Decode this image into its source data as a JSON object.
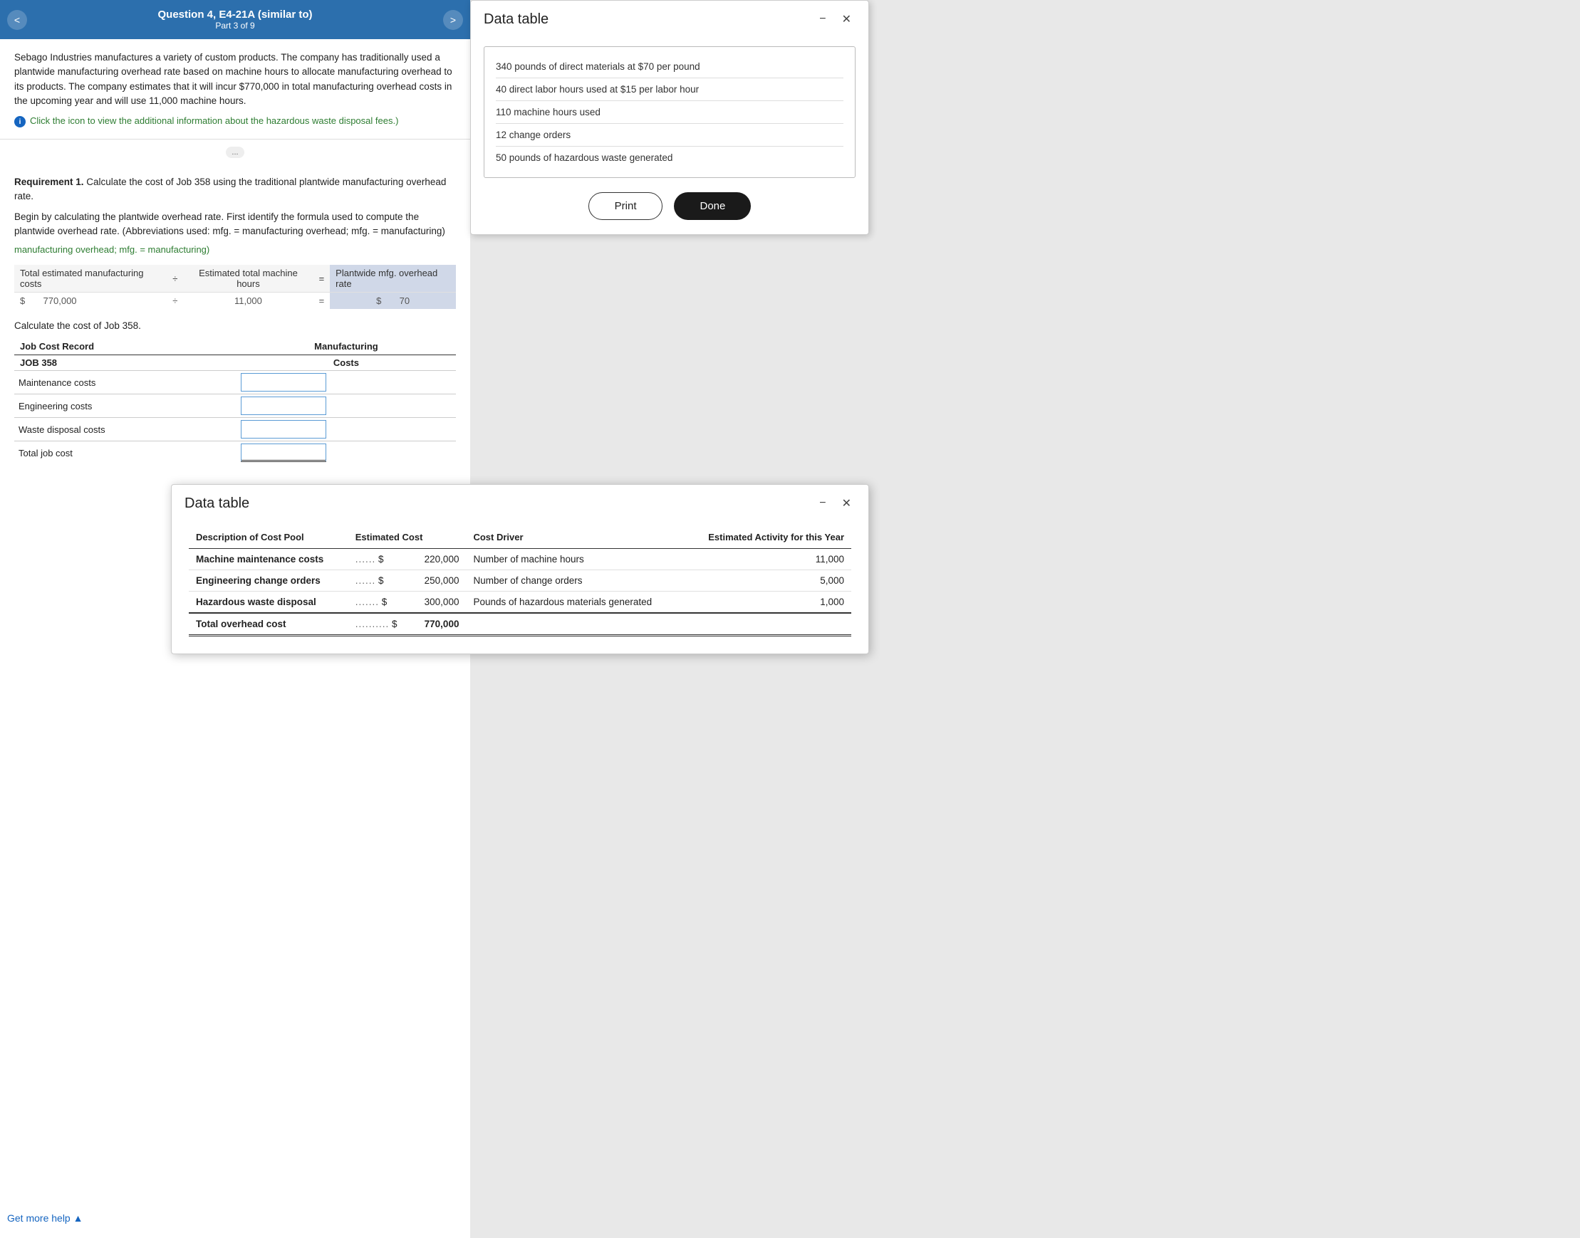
{
  "header": {
    "title": "Question 4, E4-21A (similar to)",
    "subtitle": "Part 3 of 9",
    "prev_label": "<",
    "next_label": ">"
  },
  "problem": {
    "text": "Sebago Industries manufactures a variety of custom products. The company has traditionally used a plantwide manufacturing overhead rate based on machine hours to allocate manufacturing overhead to its products. The company estimates that it will incur $770,000 in total manufacturing overhead costs in the upcoming year and will use 11,000 machine hours.",
    "info_link": "Click the icon to view the additional information about the hazardous waste disposal fees.)"
  },
  "scroll_indicator": "...",
  "requirement": {
    "text_bold": "Requirement 1.",
    "text_rest": " Calculate the cost of Job 358 using the traditional plantwide manufacturing overhead rate.",
    "begin_text": "Begin by calculating the plantwide overhead rate. First identify the formula used to compute the plantwide overhead rate. (Abbreviations used: mfg. = manufacturing overhead; mfg. = manufacturing)",
    "formula_note": "manufacturing overhead; mfg. = manufacturing)"
  },
  "formula_table": {
    "col1_header": "Total estimated manufacturing costs",
    "col2_header": "÷",
    "col3_header": "Estimated total machine hours",
    "col4_header": "=",
    "col5_header": "Plantwide mfg. overhead rate",
    "row_dollar": "$",
    "row_val1": "770,000",
    "row_div": "÷",
    "row_val2": "11,000",
    "row_eq": "=",
    "row_dollar2": "$",
    "row_result": "70"
  },
  "calc_label": "Calculate the cost of Job 358.",
  "job_table": {
    "col1_header": "Job Cost Record",
    "col2_header": "Manufacturing",
    "sub1": "JOB 358",
    "sub2": "Costs",
    "rows": [
      {
        "label": "Maintenance costs",
        "value": ""
      },
      {
        "label": "Engineering costs",
        "value": ""
      },
      {
        "label": "Waste disposal costs",
        "value": ""
      }
    ],
    "total_label": "Total job cost"
  },
  "modal1": {
    "title": "Data table",
    "items": [
      "340 pounds of direct materials at $70 per pound",
      "40 direct labor hours used at $15 per labor hour",
      "110 machine hours used",
      "12 change orders",
      "50 pounds of hazardous waste generated"
    ],
    "print_label": "Print",
    "done_label": "Done"
  },
  "modal2": {
    "title": "Data table",
    "table": {
      "col_headers": [
        "Description of Cost Pool",
        "Estimated Cost",
        "Cost Driver",
        "Estimated Activity for this Year"
      ],
      "rows": [
        {
          "description": "Machine maintenance costs",
          "dots": "......",
          "dollar": "$",
          "cost": "220,000",
          "driver": "Number of machine hours",
          "activity": "11,000"
        },
        {
          "description": "Engineering change orders",
          "dots": "......",
          "dollar": "$",
          "cost": "250,000",
          "driver": "Number of change orders",
          "activity": "5,000"
        },
        {
          "description": "Hazardous waste disposal",
          "dots": ".......",
          "dollar": "$",
          "cost": "300,000",
          "driver": "Pounds of hazardous materials generated",
          "activity": "1,000"
        }
      ],
      "total_row": {
        "label": "Total overhead cost",
        "dots": "..........",
        "dollar": "$",
        "value": "770,000"
      }
    }
  },
  "get_more_help": "Get more help ▲"
}
